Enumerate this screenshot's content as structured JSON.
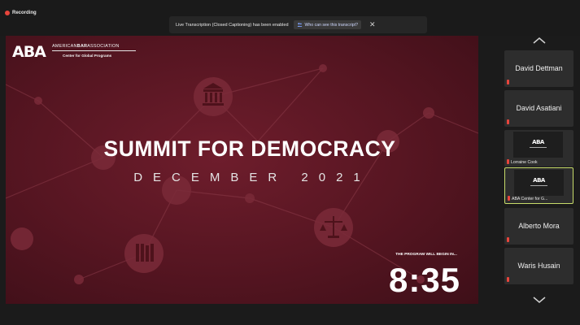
{
  "recording": {
    "label": "Recording"
  },
  "banner": {
    "text": "Live Transcription (Closed Captioning) has been enabled",
    "button_label": "Who can see this transcript?",
    "close_glyph": "✕"
  },
  "slide": {
    "logo_text": "ABA",
    "org_name_part1": "AMERICAN",
    "org_name_bold": "BAR",
    "org_name_part2": "ASSOCIATION",
    "org_subtitle": "Center for Global Programs",
    "title": "SUMMIT FOR DEMOCRACY",
    "subtitle": "DECEMBER 2021",
    "countdown_label": "THE PROGRAM WILL BEGIN IN...",
    "countdown": "8:35"
  },
  "participants": [
    {
      "name": "David Dettman",
      "video": false
    },
    {
      "name": "David Asatiani",
      "video": false
    },
    {
      "name": "Lorraine Cook",
      "video": true,
      "logo": "ABA"
    },
    {
      "name": "ABA Center for G...",
      "video": true,
      "logo": "ABA",
      "selected": true
    },
    {
      "name": "Alberto Mora",
      "video": false
    },
    {
      "name": "Waris Husain",
      "video": false
    }
  ],
  "colors": {
    "recording_dot": "#e8453c",
    "muted_mic": "#e8453c",
    "selected_border": "#c8dc6a",
    "slide_bg": "#5c1824"
  },
  "icons": {
    "scroll_up": "chevron-up-icon",
    "scroll_down": "chevron-down-icon",
    "mic_muted": "mic-muted-icon",
    "people": "people-icon",
    "close": "close-icon"
  }
}
